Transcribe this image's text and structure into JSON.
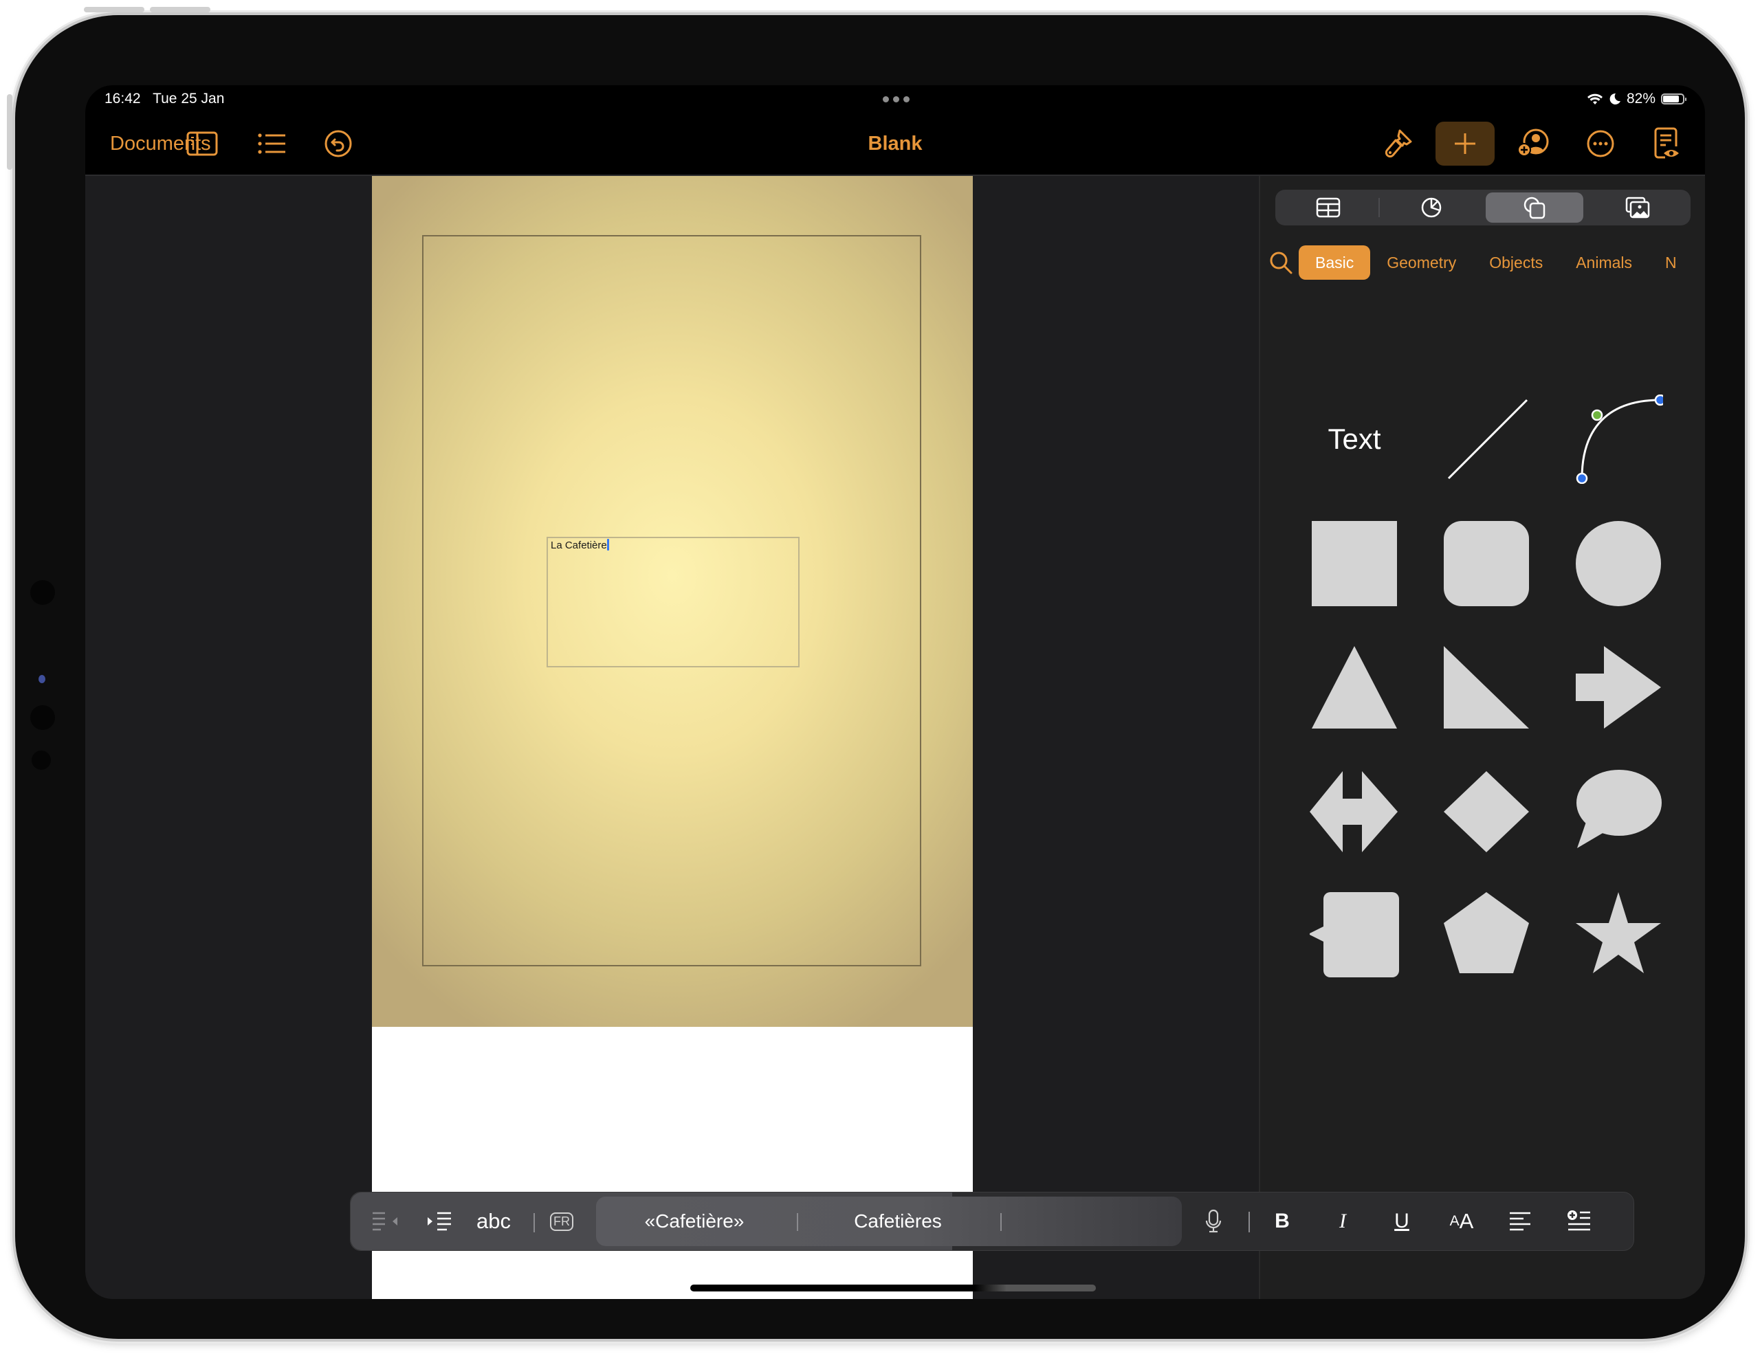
{
  "status_bar": {
    "time": "16:42",
    "date": "Tue 25 Jan",
    "battery_percent": "82%",
    "battery_level": 0.82,
    "icons": [
      "wifi-icon",
      "moon-icon",
      "battery-icon"
    ]
  },
  "toolbar": {
    "documents_label": "Documents",
    "title": "Blank",
    "left_icons": [
      "sidebar-icon",
      "list-icon",
      "undo-icon"
    ],
    "right_icons": [
      "paintbrush-icon",
      "plus-icon",
      "collaborate-icon",
      "more-icon",
      "reader-view-icon"
    ],
    "accent_color": "#e7963a"
  },
  "document": {
    "textbox_text": "La Cafetière"
  },
  "insert_panel": {
    "tabs": [
      "table-icon",
      "chart-icon",
      "shapes-icon",
      "media-icon"
    ],
    "active_tab": "shapes-icon",
    "categories": [
      "Basic",
      "Geometry",
      "Objects",
      "Animals",
      "N"
    ],
    "active_category": "Basic",
    "shapes": [
      {
        "name": "text",
        "label": "Text"
      },
      {
        "name": "line"
      },
      {
        "name": "curve"
      },
      {
        "name": "square"
      },
      {
        "name": "rounded-square"
      },
      {
        "name": "circle"
      },
      {
        "name": "triangle"
      },
      {
        "name": "right-triangle"
      },
      {
        "name": "arrow"
      },
      {
        "name": "double-arrow"
      },
      {
        "name": "diamond"
      },
      {
        "name": "speech-bubble"
      },
      {
        "name": "callout-square"
      },
      {
        "name": "pentagon"
      },
      {
        "name": "star"
      }
    ]
  },
  "format_bar": {
    "abc_label": "abc",
    "language_badge": "FR",
    "suggestions": [
      "«Cafetière»",
      "Cafetières",
      ""
    ],
    "buttons": [
      "bold",
      "italic",
      "underline",
      "font-size",
      "align",
      "insert-list"
    ]
  }
}
